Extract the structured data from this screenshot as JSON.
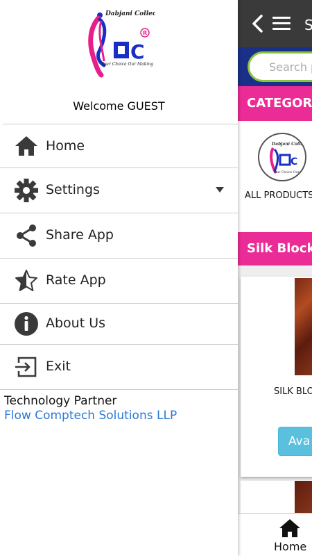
{
  "drawer": {
    "welcome": "Welcome GUEST",
    "logo": {
      "brand_top": "Dabjani Collection",
      "letters": "DC",
      "tagline": "Your Choice Our Making"
    },
    "items": [
      {
        "label": "Home",
        "icon": "home-icon"
      },
      {
        "label": "Settings",
        "icon": "gear-icon",
        "has_dropdown": true
      },
      {
        "label": "Share App",
        "icon": "share-icon"
      },
      {
        "label": "Rate App",
        "icon": "star-half-icon"
      },
      {
        "label": "About Us",
        "icon": "info-icon"
      },
      {
        "label": "Exit",
        "icon": "exit-icon"
      }
    ],
    "footer": {
      "label": "Technology Partner",
      "link": "Flow Comptech Solutions LLP"
    }
  },
  "app": {
    "title_fragment": "S",
    "search_placeholder": "Search p",
    "categories_heading": "CATEGORI",
    "category_label": "ALL PRODUCTS",
    "section_heading": "Silk Block P",
    "product_name": "SILK BLO",
    "button_label": "Ava",
    "bottom_nav_label": "Home"
  },
  "colors": {
    "pink": "#ec2c96",
    "navy": "#1a3088",
    "green": "#8ac43f",
    "topbar": "#3a3a3a",
    "link": "#2b78d6",
    "button": "#5bc0de"
  }
}
